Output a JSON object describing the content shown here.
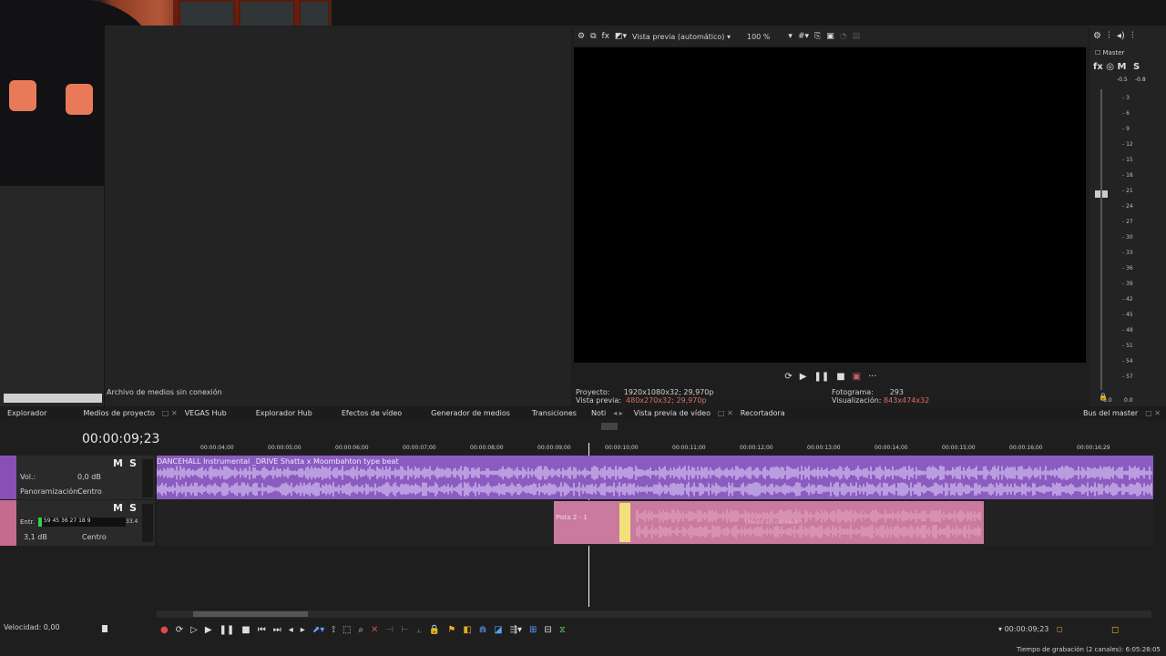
{
  "preview": {
    "mode_label": "Vista previa (automático) ▾",
    "zoom_label": "100 %",
    "project_label": "Proyecto:",
    "project_value": "1920x1080x32; 29,970p",
    "preview_label": "Vista previa:",
    "preview_value": "480x270x32; 29,970p",
    "frame_label": "Fotograma:",
    "frame_value": "293",
    "display_label": "Visualización:",
    "display_value": "843x474x32"
  },
  "left": {
    "offline_label": "Archivo de medios sin conexión"
  },
  "master": {
    "title": "Master",
    "fx": "fx",
    "m": "M",
    "s": "S",
    "peak_left": "-0.5",
    "peak_right": "-0.8",
    "ticks": [
      "3",
      "6",
      "9",
      "12",
      "15",
      "18",
      "21",
      "24",
      "27",
      "30",
      "33",
      "36",
      "39",
      "42",
      "45",
      "48",
      "51",
      "54",
      "57"
    ],
    "bottom_left": "0.0",
    "bottom_right": "0.0"
  },
  "tabs": {
    "items": [
      "Explorador",
      "Medios de proyecto",
      "VEGAS Hub",
      "Explorador Hub",
      "Efectos de vídeo",
      "Generador de medios",
      "Transiciones",
      "Noti"
    ],
    "preview_tab": "Vista previa de vídeo",
    "trimmer_tab": "Recortadora",
    "master_bus_tab": "Bus del master"
  },
  "timeline": {
    "timecode": "00:00:09;23",
    "ruler_labels": [
      "00:00:04;00",
      "00:00:05;00",
      "00:00:06;00",
      "00:00:07;00",
      "00:00:08;00",
      "00:00:09;00",
      "00:00:10;00",
      "00:00:11;00",
      "00:00:12;00",
      "00:00:13;00",
      "00:00:14;00",
      "00:00:15;00",
      "00:00:16;00",
      "00:00:16;29"
    ],
    "track1": {
      "m": "M",
      "s": "S",
      "vol_label": "Vol.:",
      "vol_value": "0,0 dB",
      "pan_label": "Panoramización:",
      "pan_value": "Centro",
      "clip_name": "DANCEHALL Instrumental _DRIVE Shatta x Moombahton type beat"
    },
    "track2": {
      "m": "M",
      "s": "S",
      "input_label": "Entr.",
      "input_meter": "59 45 36 27 18 9",
      "input_extra": "33.4",
      "vol_value": "3,1 dB",
      "pan_value": "Centro",
      "clip_name": "Pista 2 - 1",
      "clip_offline": "(Medio sin conexión)"
    }
  },
  "bottom": {
    "speed_label": "Velocidad: 0,00",
    "cursor_time": "00:00:09;23",
    "recording_time": "Tiempo de grabación (2 canales): 6:05:28:05"
  }
}
